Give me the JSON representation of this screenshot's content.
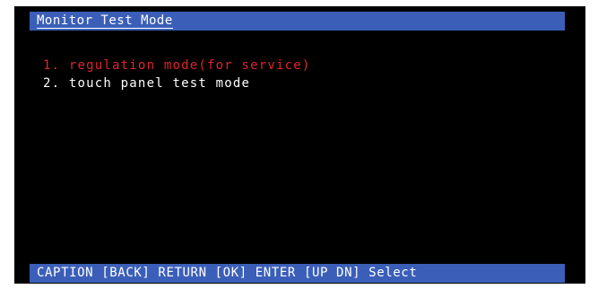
{
  "window": {
    "title": "Monitor Test Mode"
  },
  "menu": {
    "items": [
      {
        "number": "1.",
        "label": "regulation mode(for service)",
        "selected": true
      },
      {
        "number": "2.",
        "label": "touch panel test mode",
        "selected": false
      }
    ]
  },
  "status_bar": {
    "text": "CAPTION [BACK] RETURN [OK] ENTER [UP DN] Select"
  },
  "colors": {
    "background": "#000000",
    "bar": "#3b5fb8",
    "selected_text": "#e0242a",
    "normal_text": "#ffffff"
  }
}
